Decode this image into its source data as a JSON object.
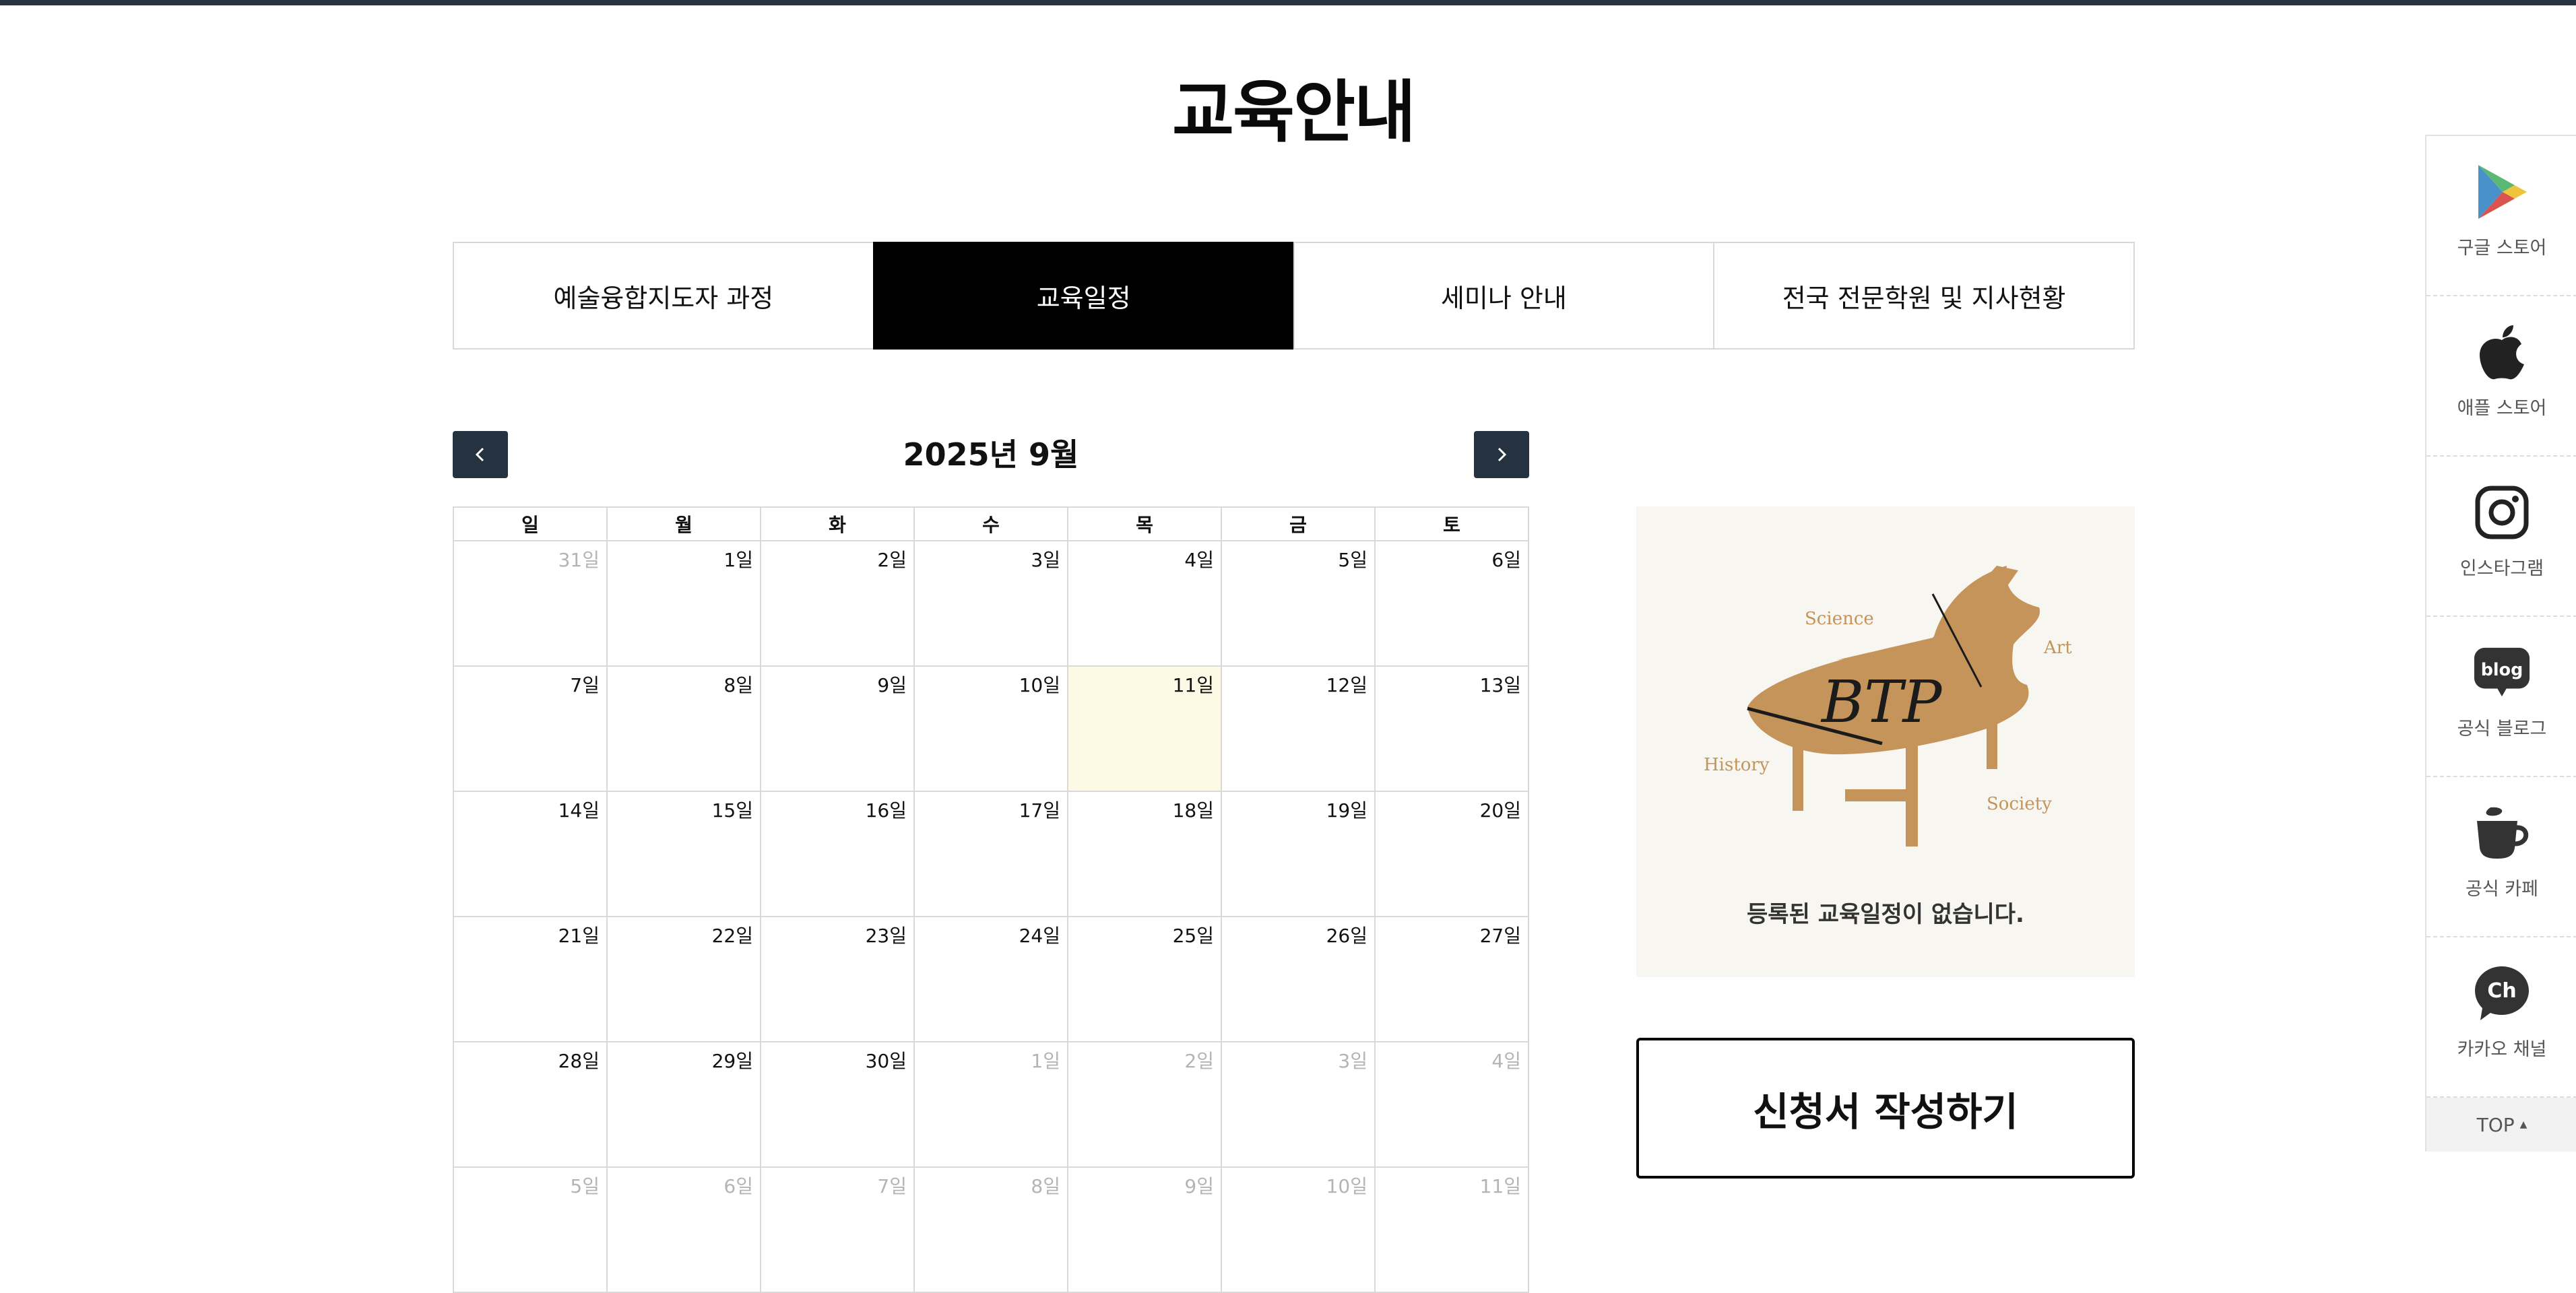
{
  "page": {
    "title": "교육안내"
  },
  "tabs": [
    {
      "label": "예술융합지도자 과정",
      "active": false
    },
    {
      "label": "교육일정",
      "active": true
    },
    {
      "label": "세미나 안내",
      "active": false
    },
    {
      "label": "전국 전문학원 및 지사현황",
      "active": false
    }
  ],
  "calendar": {
    "title": "2025년 9월",
    "weekdays": [
      "일",
      "월",
      "화",
      "수",
      "목",
      "금",
      "토"
    ],
    "weeks": [
      [
        {
          "d": "31일",
          "m": true
        },
        {
          "d": "1일"
        },
        {
          "d": "2일"
        },
        {
          "d": "3일"
        },
        {
          "d": "4일"
        },
        {
          "d": "5일"
        },
        {
          "d": "6일"
        }
      ],
      [
        {
          "d": "7일"
        },
        {
          "d": "8일"
        },
        {
          "d": "9일"
        },
        {
          "d": "10일"
        },
        {
          "d": "11일",
          "today": true
        },
        {
          "d": "12일"
        },
        {
          "d": "13일"
        }
      ],
      [
        {
          "d": "14일"
        },
        {
          "d": "15일"
        },
        {
          "d": "16일"
        },
        {
          "d": "17일"
        },
        {
          "d": "18일"
        },
        {
          "d": "19일"
        },
        {
          "d": "20일"
        }
      ],
      [
        {
          "d": "21일"
        },
        {
          "d": "22일"
        },
        {
          "d": "23일"
        },
        {
          "d": "24일"
        },
        {
          "d": "25일"
        },
        {
          "d": "26일"
        },
        {
          "d": "27일"
        }
      ],
      [
        {
          "d": "28일"
        },
        {
          "d": "29일"
        },
        {
          "d": "30일"
        },
        {
          "d": "1일",
          "m": true
        },
        {
          "d": "2일",
          "m": true
        },
        {
          "d": "3일",
          "m": true
        },
        {
          "d": "4일",
          "m": true
        }
      ],
      [
        {
          "d": "5일",
          "m": true
        },
        {
          "d": "6일",
          "m": true
        },
        {
          "d": "7일",
          "m": true
        },
        {
          "d": "8일",
          "m": true
        },
        {
          "d": "9일",
          "m": true
        },
        {
          "d": "10일",
          "m": true
        },
        {
          "d": "11일",
          "m": true
        }
      ]
    ]
  },
  "empty_state": {
    "logo_text": "BTP",
    "logo_words": [
      "Science",
      "Art",
      "History",
      "Society"
    ],
    "message": "등록된 교육일정이 없습니다."
  },
  "apply_button": "신청서 작성하기",
  "quick_menu": {
    "items": [
      {
        "label": "구글 스토어",
        "icon": "google-play-icon"
      },
      {
        "label": "애플 스토어",
        "icon": "apple-icon"
      },
      {
        "label": "인스타그램",
        "icon": "instagram-icon"
      },
      {
        "label": "공식 블로그",
        "icon": "blog-icon",
        "icon_text": "blog"
      },
      {
        "label": "공식 카페",
        "icon": "cafe-cup-icon"
      },
      {
        "label": "카카오 채널",
        "icon": "kakao-channel-icon",
        "icon_text": "Ch"
      }
    ],
    "top_label": "TOP"
  },
  "colors": {
    "accent": "#253340",
    "active_tab": "#000000",
    "today": "#fef9e4",
    "logo": "#c4945a"
  }
}
